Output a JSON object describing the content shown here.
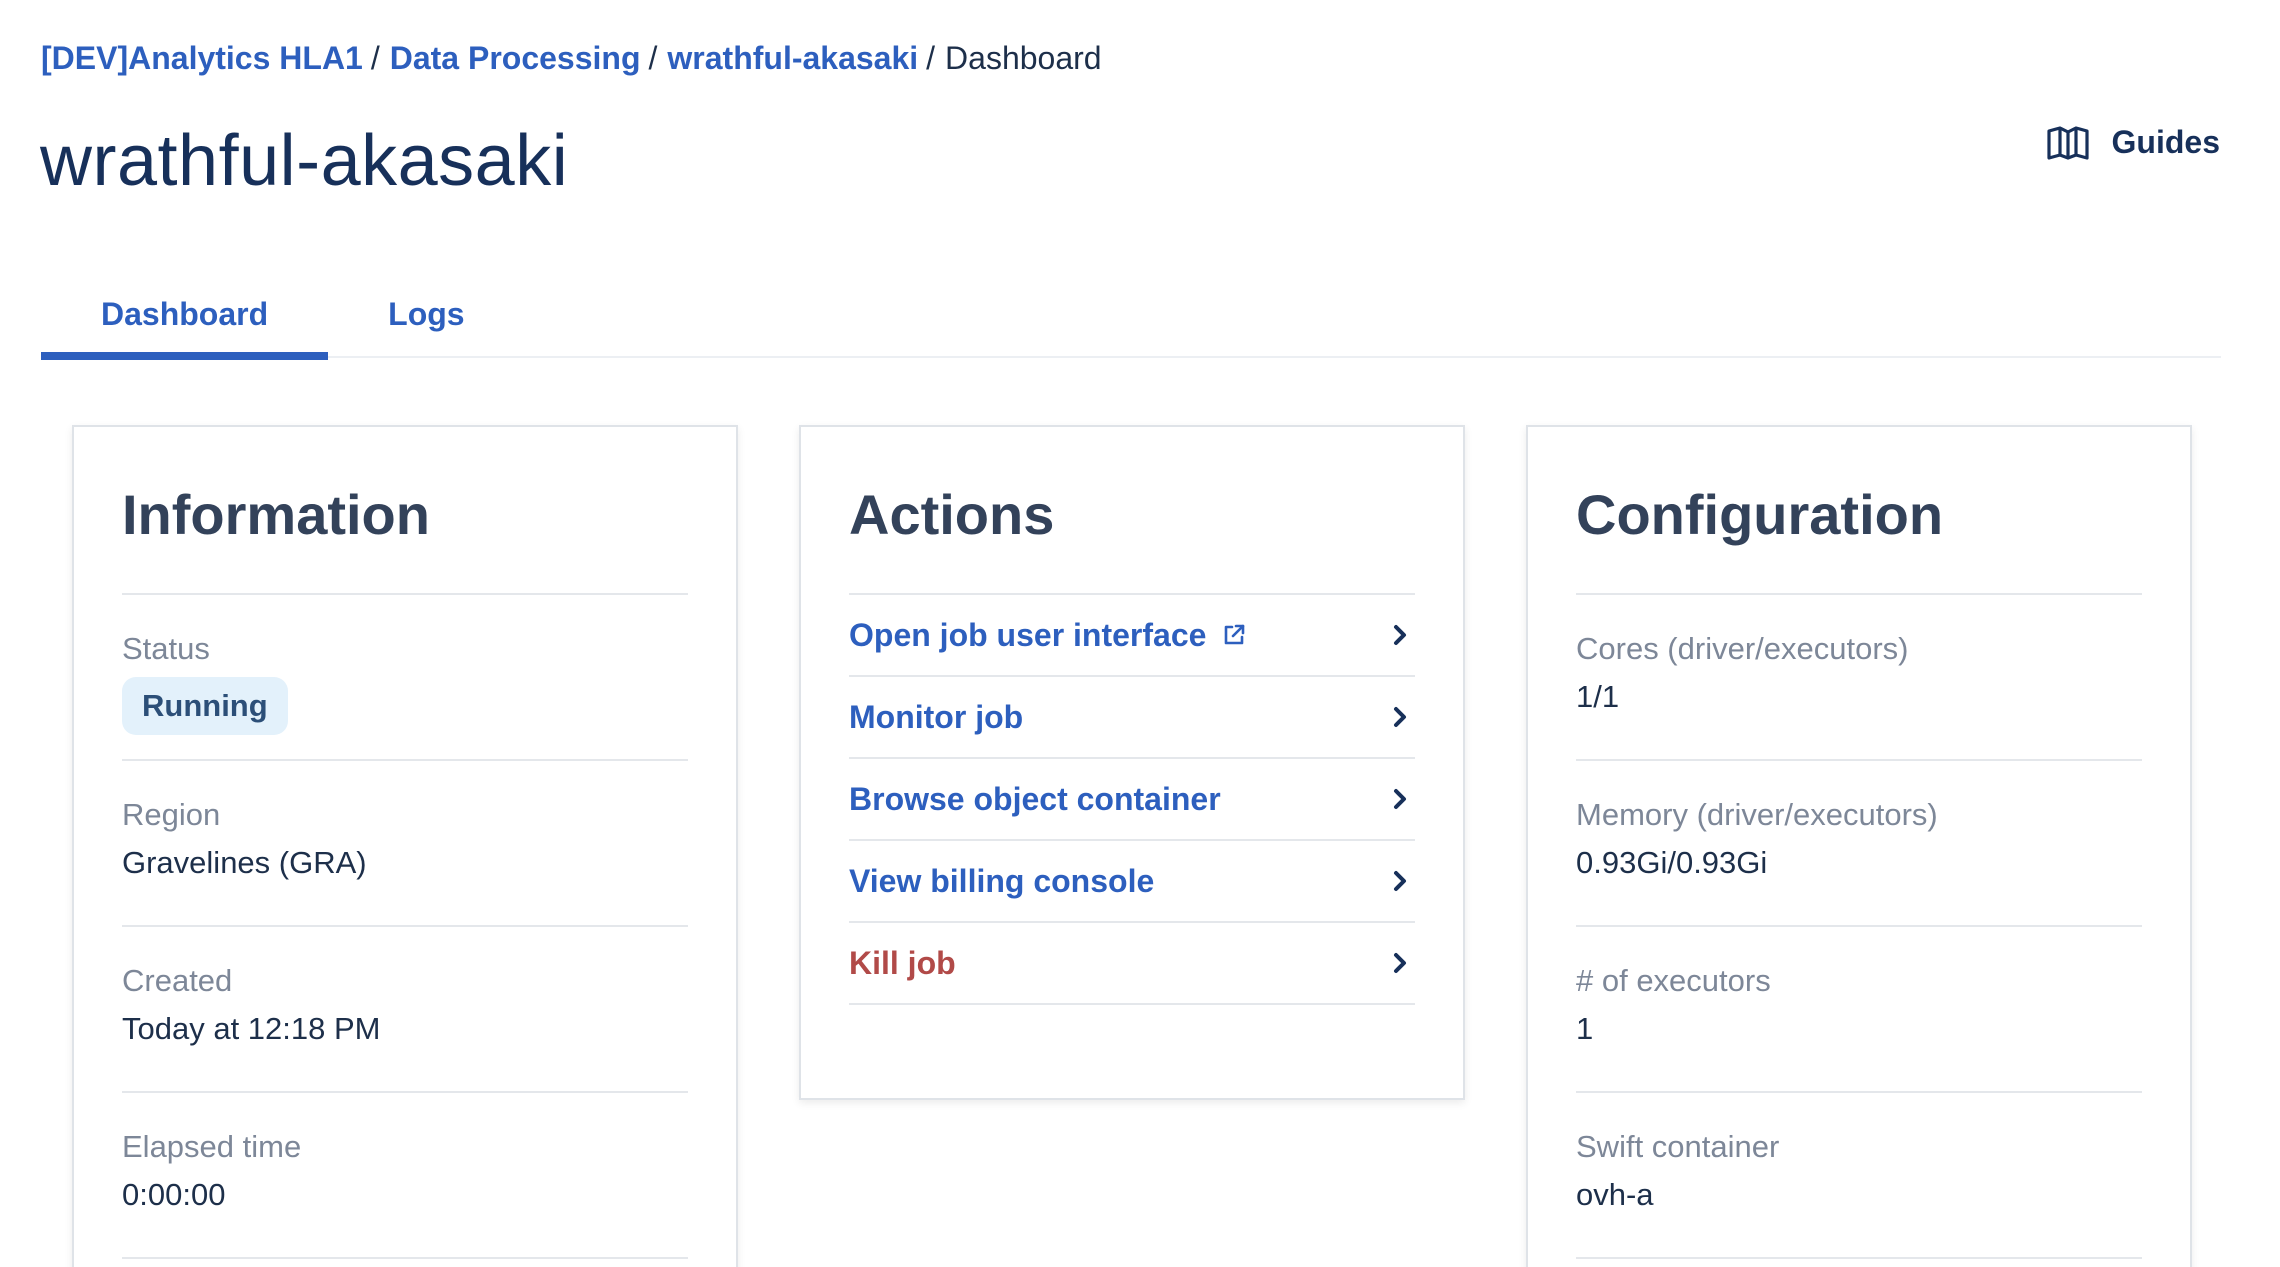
{
  "breadcrumb": {
    "items": [
      "[DEV]Analytics HLA1",
      "Data Processing",
      "wrathful-akasaki"
    ],
    "current": "Dashboard",
    "separator": "/"
  },
  "page": {
    "title": "wrathful-akasaki"
  },
  "guides": {
    "label": "Guides"
  },
  "tabs": [
    {
      "label": "Dashboard",
      "active": true
    },
    {
      "label": "Logs",
      "active": false
    }
  ],
  "information": {
    "title": "Information",
    "status_label": "Status",
    "status_value": "Running",
    "region_label": "Region",
    "region_value": "Gravelines (GRA)",
    "created_label": "Created",
    "created_value": "Today at 12:18 PM",
    "elapsed_label": "Elapsed time",
    "elapsed_value": "0:00:00"
  },
  "actions": {
    "title": "Actions",
    "items": [
      {
        "label": "Open job user interface",
        "external": true
      },
      {
        "label": "Monitor job"
      },
      {
        "label": "Browse object container"
      },
      {
        "label": "View billing console"
      },
      {
        "label": "Kill job",
        "danger": true
      }
    ]
  },
  "configuration": {
    "title": "Configuration",
    "cores_label": "Cores (driver/executors)",
    "cores_value": "1/1",
    "memory_label": "Memory (driver/executors)",
    "memory_value": "0.93Gi/0.93Gi",
    "executors_label": "# of executors",
    "executors_value": "1",
    "swift_label": "Swift container",
    "swift_value": "ovh-a"
  },
  "colors": {
    "link": "#2d5fbe",
    "danger": "#b14a48",
    "title": "#17305a",
    "badge_bg": "#e3f1fb"
  },
  "icons": {
    "guides": "book-map-icon",
    "external": "external-link-icon",
    "chevron": "chevron-right-icon"
  }
}
